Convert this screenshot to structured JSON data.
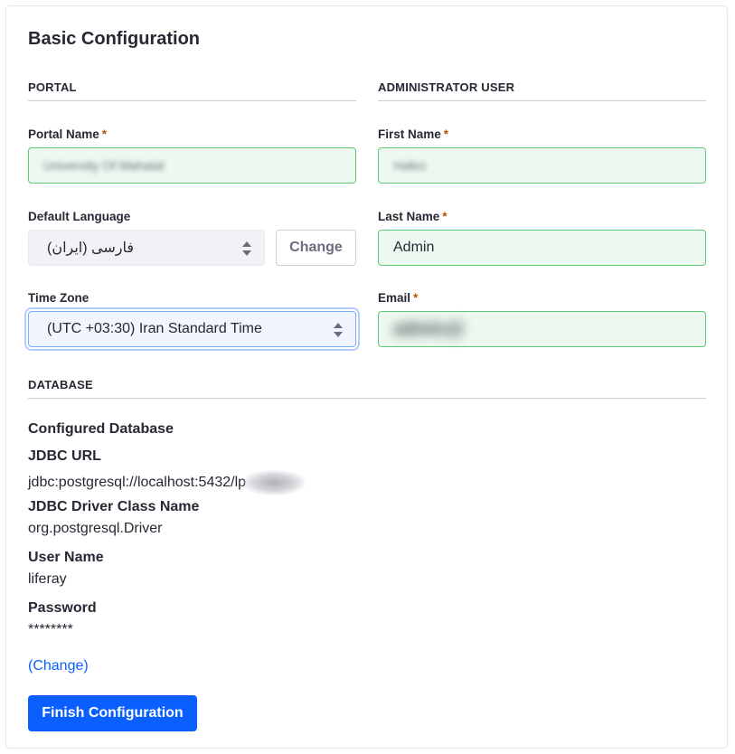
{
  "title": "Basic Configuration",
  "portal": {
    "heading": "PORTAL",
    "portal_name": {
      "label": "Portal Name",
      "required": "*",
      "value": "University Of Mahalat"
    },
    "default_language": {
      "label": "Default Language",
      "value": "فارسی (ایران)",
      "change_label": "Change"
    },
    "time_zone": {
      "label": "Time Zone",
      "value": "(UTC +03:30) Iran Standard Time"
    }
  },
  "admin": {
    "heading": "ADMINISTRATOR USER",
    "first_name": {
      "label": "First Name",
      "required": "*",
      "value": "Hafez"
    },
    "last_name": {
      "label": "Last Name",
      "required": "*",
      "value": "Admin"
    },
    "email": {
      "label": "Email",
      "required": "*",
      "value": "admin@"
    }
  },
  "database": {
    "heading": "DATABASE",
    "configured_label": "Configured Database",
    "jdbc_url_label": "JDBC URL",
    "jdbc_url_value": "jdbc:postgresql://localhost:5432/lp",
    "driver_label": "JDBC Driver Class Name",
    "driver_value": "org.postgresql.Driver",
    "user_label": "User Name",
    "user_value": "liferay",
    "password_label": "Password",
    "password_value": "********",
    "change_link": "(Change)"
  },
  "finish_button": "Finish Configuration",
  "colors": {
    "primary": "#0b5fff",
    "valid_bg": "#edf9f0",
    "valid_border": "#5aca75",
    "required": "#b95000"
  }
}
